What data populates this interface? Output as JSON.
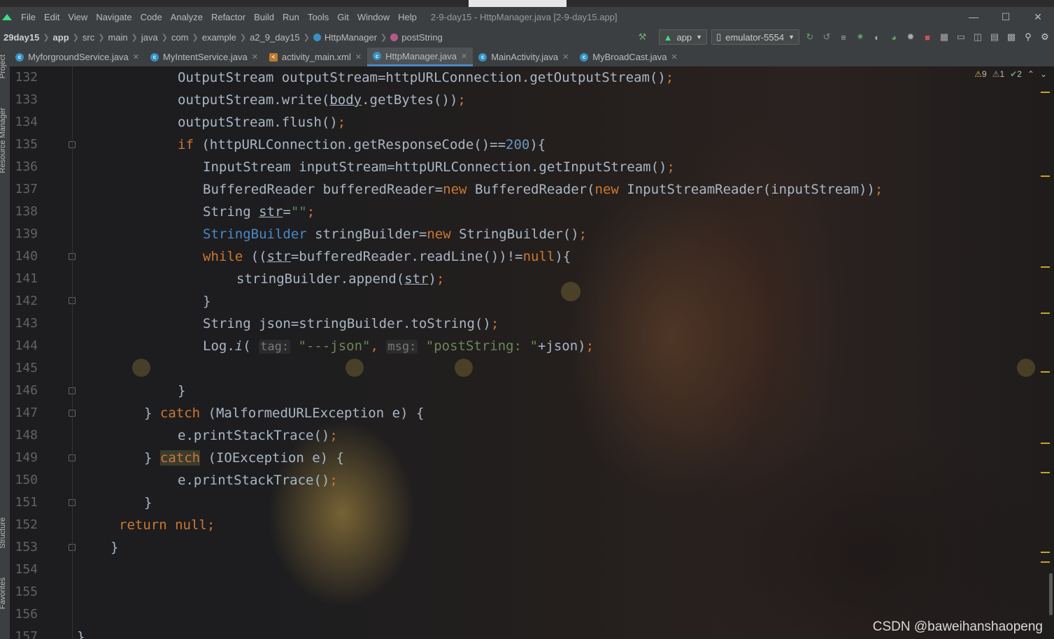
{
  "menu": {
    "items": [
      "File",
      "Edit",
      "View",
      "Navigate",
      "Code",
      "Analyze",
      "Refactor",
      "Build",
      "Run",
      "Tools",
      "Git",
      "Window",
      "Help"
    ],
    "title": "2-9-day15 - HttpManager.java [2-9-day15.app]"
  },
  "breadcrumb": {
    "items": [
      "29day15",
      "app",
      "src",
      "main",
      "java",
      "com",
      "example",
      "a2_9_day15",
      "HttpManager",
      "postString"
    ]
  },
  "toolbar": {
    "config": "app",
    "device": "emulator-5554"
  },
  "tabs": [
    {
      "label": "MyforgroundService.java",
      "icon": "java-class-icon",
      "active": false
    },
    {
      "label": "MyIntentService.java",
      "icon": "java-class-icon",
      "active": false
    },
    {
      "label": "activity_main.xml",
      "icon": "xml-layout-icon",
      "active": false
    },
    {
      "label": "HttpManager.java",
      "icon": "java-class-icon",
      "active": true
    },
    {
      "label": "MainActivity.java",
      "icon": "java-class-icon",
      "active": false
    },
    {
      "label": "MyBroadCast.java",
      "icon": "java-class-icon",
      "active": false
    }
  ],
  "sidebar": {
    "project": "Project",
    "resource_manager": "Resource Manager",
    "structure": "Structure",
    "favorites": "Favorites"
  },
  "inspections": {
    "warnings": "9",
    "weak_warnings": "1",
    "typos": "2"
  },
  "line_numbers": [
    "132",
    "133",
    "134",
    "135",
    "136",
    "137",
    "138",
    "139",
    "140",
    "141",
    "142",
    "143",
    "144",
    "145",
    "146",
    "147",
    "148",
    "149",
    "150",
    "151",
    "152",
    "153",
    "154",
    "155",
    "156",
    "157"
  ],
  "watermark": "CSDN @baweihanshaopeng",
  "colors": {
    "keyword": "#cc7832",
    "number": "#6897bb",
    "string": "#6a8759",
    "class": "#4a88c7",
    "text": "#a9b7c6"
  }
}
